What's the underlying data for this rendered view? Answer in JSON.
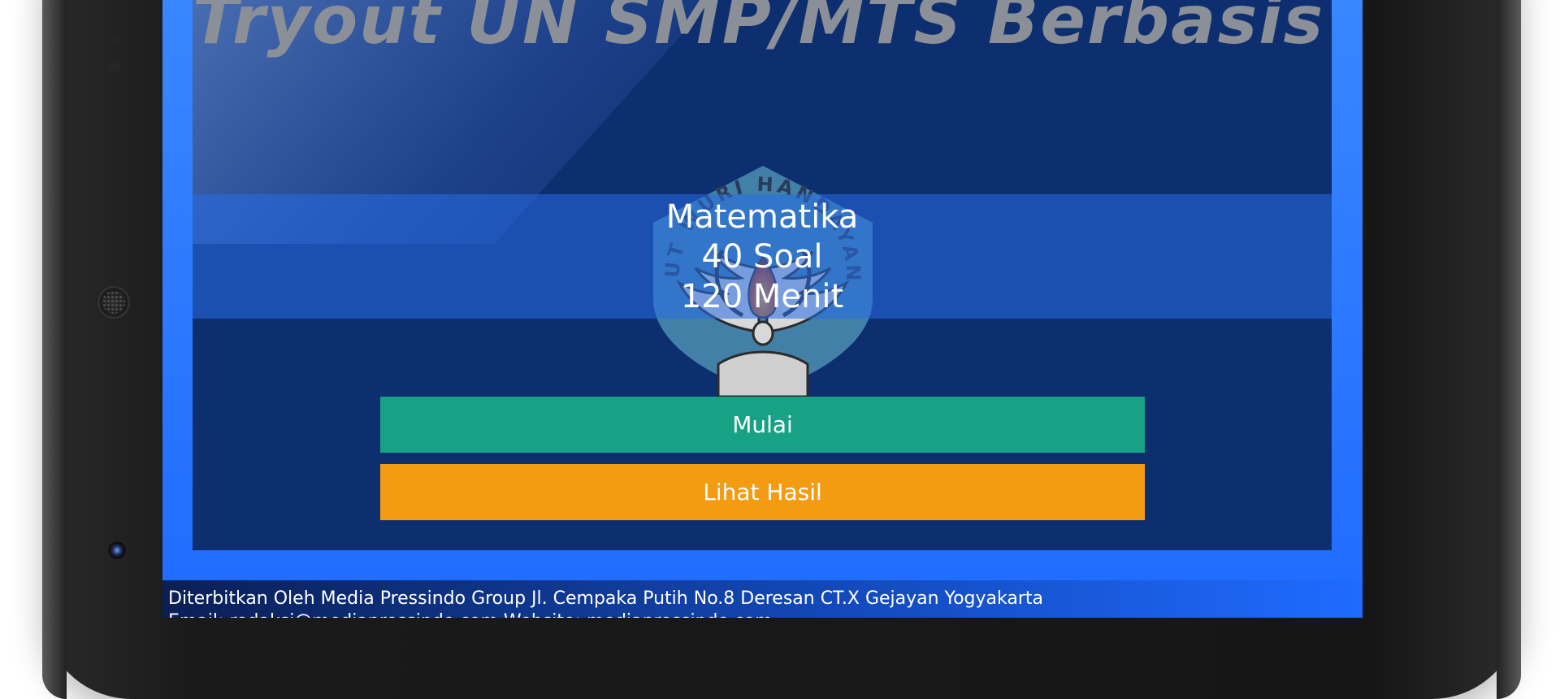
{
  "app": {
    "title": "Tryout UN SMP/MTS Berbasis CBT"
  },
  "exam": {
    "subject": "Matematika",
    "questions": "40 Soal",
    "duration": "120 Menit"
  },
  "buttons": {
    "start_label": "Mulai",
    "results_label": "Lihat Hasil"
  },
  "footer": {
    "publisher_line": "Diterbitkan Oleh Media Pressindo Group Jl. Cempaka Putih No.8 Deresan CT.X Gejayan Yogyakarta",
    "contact_line": "Email: redaksi@mediapressindo.com  Website: mediapressindo.com"
  },
  "emblem": {
    "icon": "tut-wuri-handayani-emblem-icon",
    "motto": "TUT WURI HANDAYANI"
  },
  "colors": {
    "screen_blue": "#1f72ff",
    "panel_navy": "#0d2e6f",
    "start_green": "#17a185",
    "results_orange": "#f39c12",
    "title_gray": "#8a8f98"
  }
}
